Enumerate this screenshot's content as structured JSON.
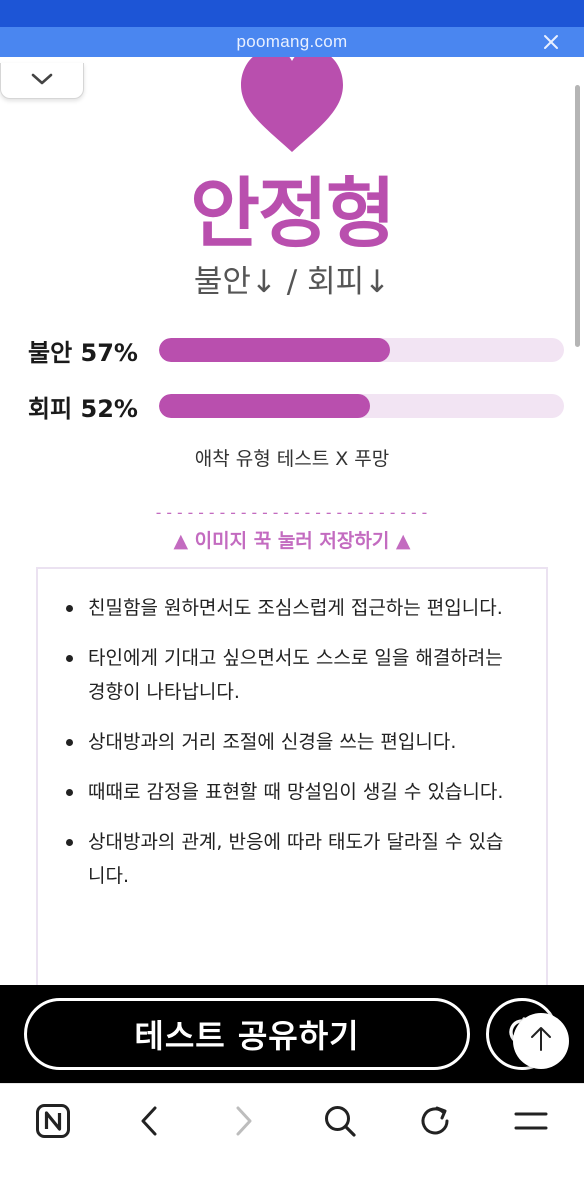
{
  "browser": {
    "url": "poomang.com"
  },
  "result": {
    "type_name": "안정형",
    "subtitle": "불안↓ / 회피↓",
    "accent_color": "#b94fae",
    "track_color": "#f2e4f3",
    "stats": [
      {
        "label": "불안 57%",
        "percent": 57
      },
      {
        "label": "회피 52%",
        "percent": 52
      }
    ],
    "credit": "애착 유형 테스트  X 푸망",
    "dashes": "--------------------------",
    "save_hint": "▲ 이미지 꾹 눌러 저장하기 ▲"
  },
  "description": {
    "items": [
      "친밀함을 원하면서도 조심스럽게 접근하는 편입니다.",
      "타인에게 기대고 싶으면서도 스스로 일을 해결하려는 경향이 나타납니다.",
      "상대방과의 거리 조절에 신경을 쓰는 편입니다.",
      "때때로 감정을 표현할 때 망설임이 생길 수 있습니다.",
      "상대방과의 관계, 반응에 따라 태도가 달라질 수 있습니다."
    ]
  },
  "share": {
    "label": "테스트 공유하기"
  },
  "icons": {
    "close": "close-icon",
    "collapse": "chevron-down-icon",
    "heart": "heart-icon",
    "refresh": "refresh-icon",
    "scroll_top": "arrow-up-icon",
    "home": "naver-n-icon",
    "back": "chevron-left-icon",
    "forward": "chevron-right-icon",
    "search": "search-icon",
    "reload": "reload-icon",
    "menu": "menu-icon"
  }
}
